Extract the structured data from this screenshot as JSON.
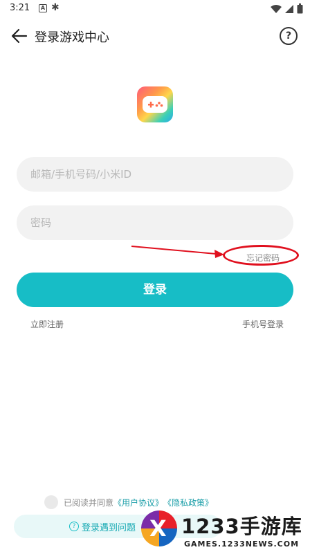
{
  "status_bar": {
    "time": "3:21",
    "icon_a": "A"
  },
  "header": {
    "title": "登录游戏中心",
    "help_icon": "?"
  },
  "form": {
    "account_placeholder": "邮箱/手机号码/小米ID",
    "password_placeholder": "密码",
    "forgot_label": "忘记密码",
    "login_label": "登录",
    "register_label": "立即注册",
    "phone_login_label": "手机号登录"
  },
  "agreement": {
    "prefix": "已阅读并同意",
    "user_agreement": "《用户协议》",
    "privacy_policy": "《隐私政策》"
  },
  "help_bar": {
    "label": "登录遇到问题",
    "icon": "?"
  },
  "watermark": {
    "brand": "1233手游库",
    "url": "GAMES.1233NEWS.COM",
    "logo_glyph": "X"
  },
  "colors": {
    "accent": "#17bdc6",
    "annotation": "#e0101e",
    "input_bg": "#f2f2f2"
  }
}
